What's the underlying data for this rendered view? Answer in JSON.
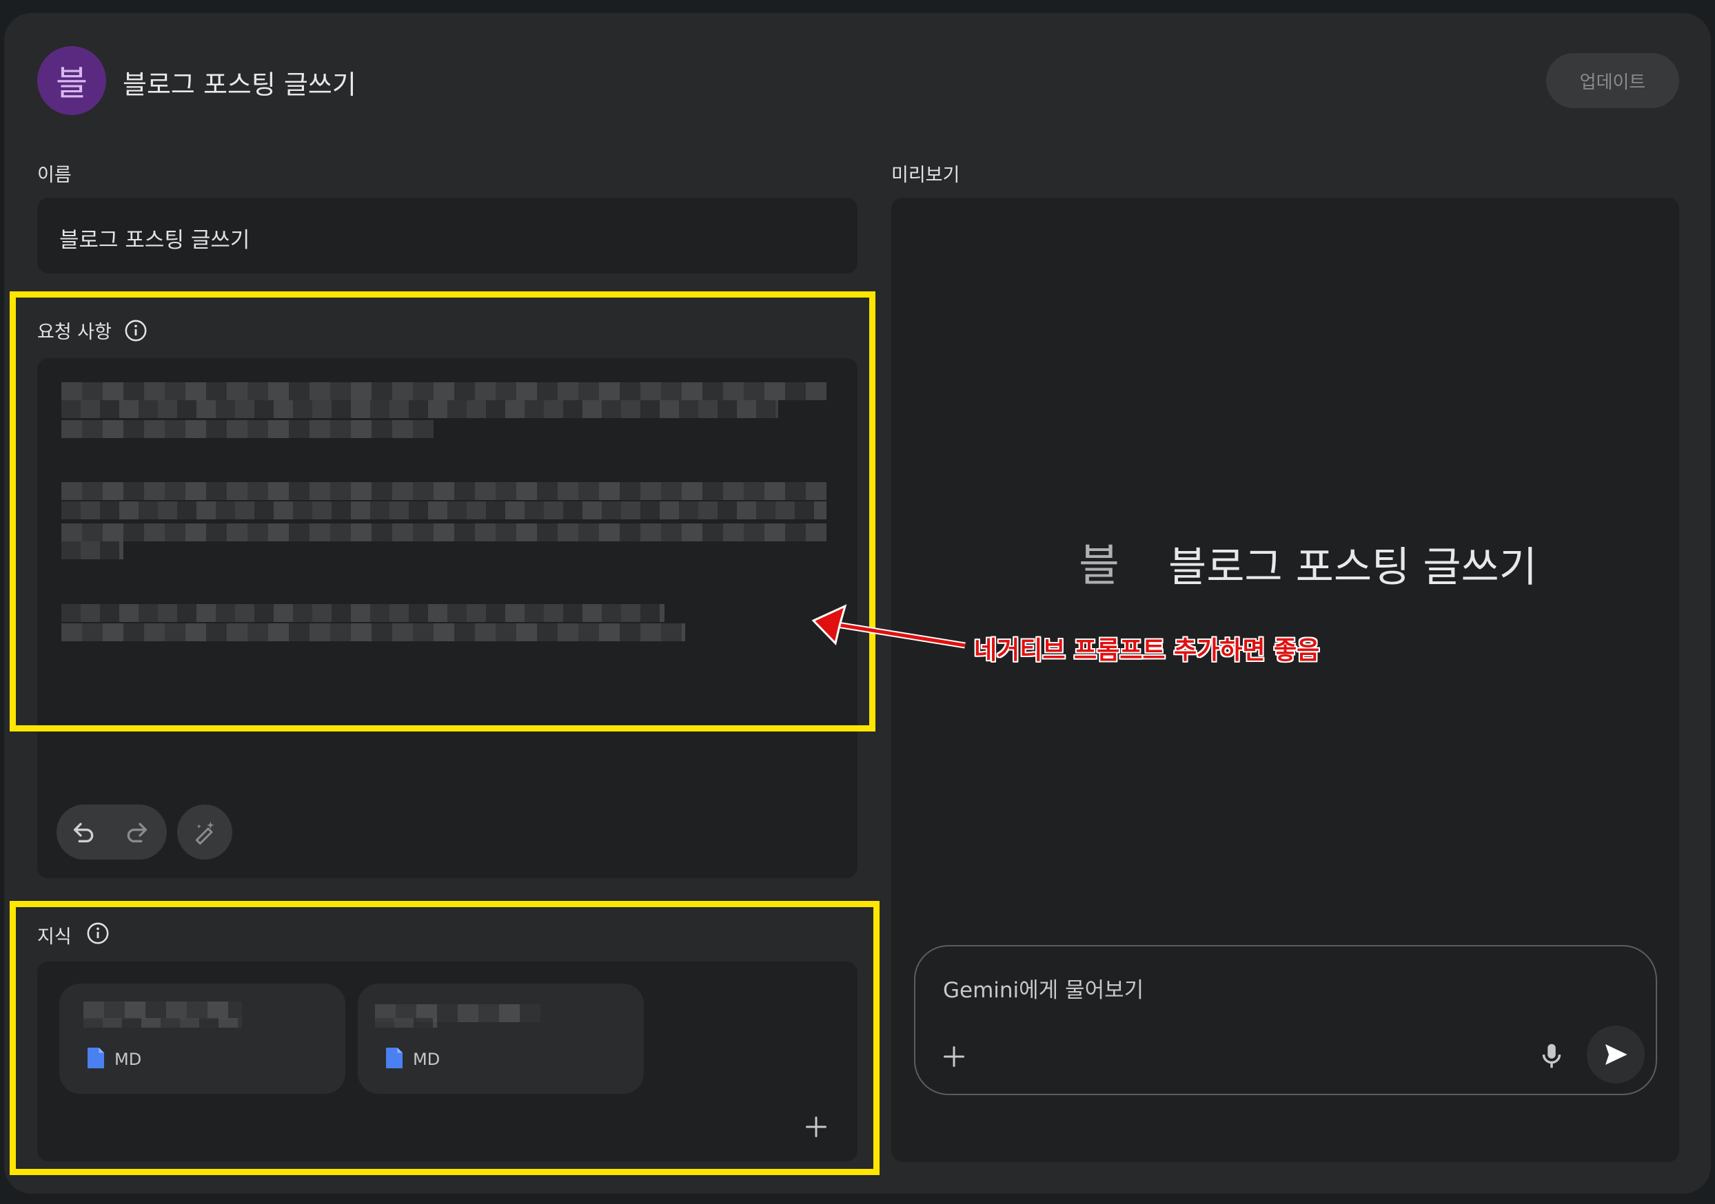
{
  "header": {
    "avatar_letter": "블",
    "title": "블로그 포스팅 글쓰기",
    "update_label": "업데이트"
  },
  "form": {
    "name_label": "이름",
    "name_value": "블로그 포스팅 글쓰기",
    "instructions_label": "요청 사항",
    "knowledge_label": "지식",
    "files": [
      {
        "type": "MD"
      },
      {
        "type": "MD"
      }
    ]
  },
  "preview": {
    "label": "미리보기",
    "avatar_letter": "블",
    "title": "블로그 포스팅 글쓰기",
    "input_placeholder": "Gemini에게 물어보기"
  },
  "annotation": {
    "text": "네거티브 프롬프트 추가하면 좋음",
    "color": "#e01010",
    "highlight_color": "#ffe600"
  },
  "icons": [
    "info-icon",
    "undo-icon",
    "redo-icon",
    "magic-wand-icon",
    "file-icon",
    "plus-icon",
    "mic-icon",
    "send-icon"
  ]
}
